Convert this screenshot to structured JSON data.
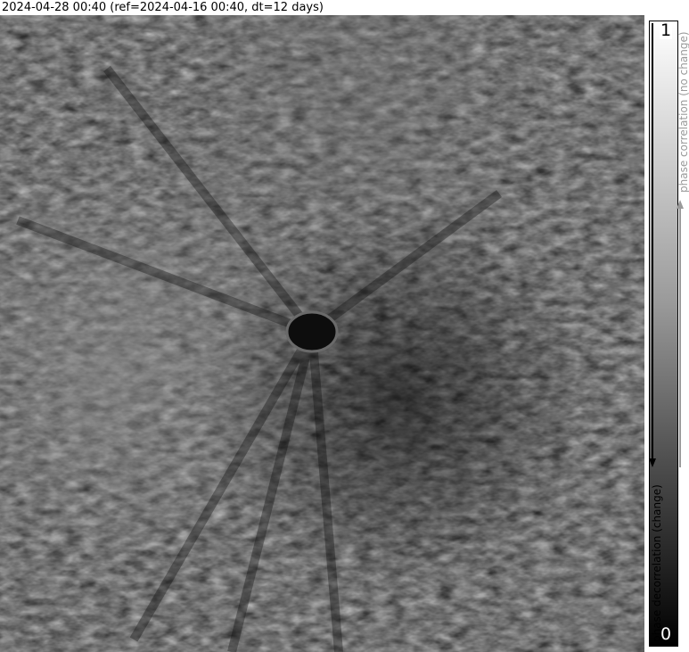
{
  "title": "2024-04-28 00:40 (ref=2024-04-16 00:40, dt=12 days)",
  "image": {
    "description_icon": "sar-coherence-image"
  },
  "colorbar": {
    "max_label": "1",
    "min_label": "0",
    "top_label": "phase correlation (no change)",
    "bottom_label": "phase decorrelation (change)",
    "top_color": "#ffffff",
    "bottom_color": "#000000",
    "label_top_color": "#9a9a9a",
    "label_bottom_color": "#000000"
  }
}
